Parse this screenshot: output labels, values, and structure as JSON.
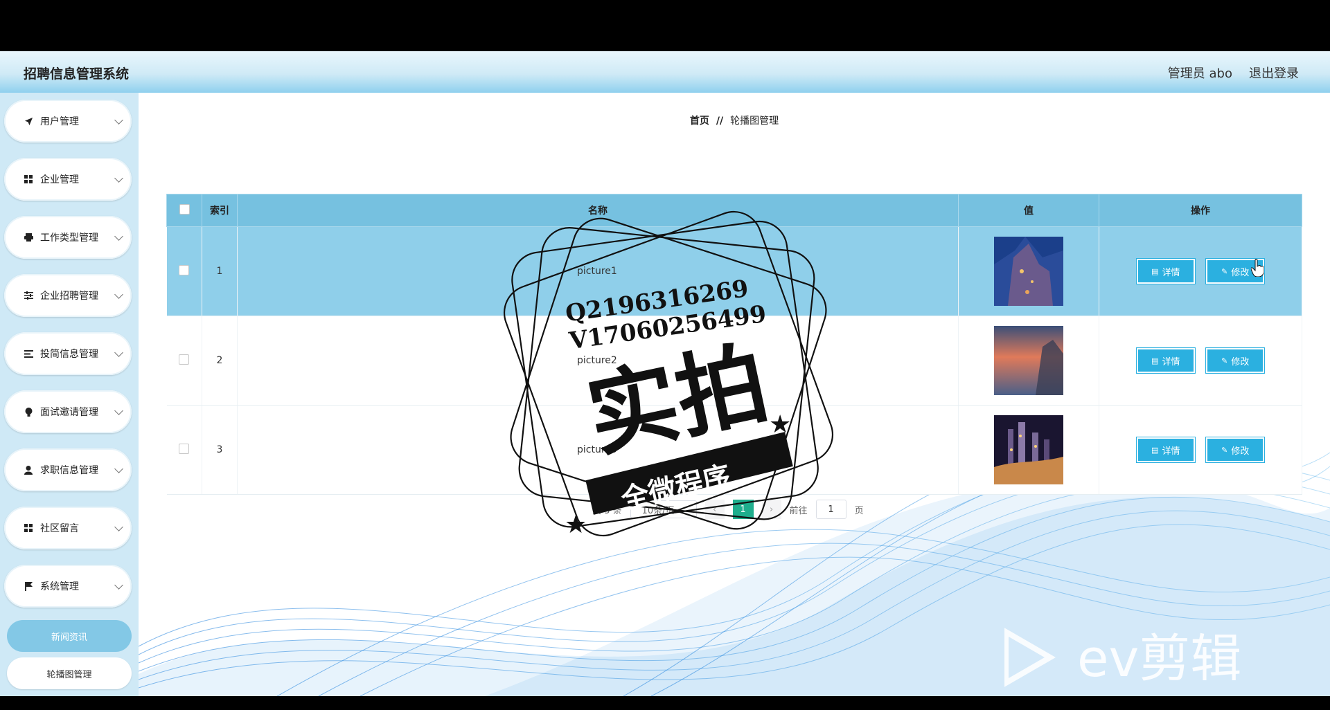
{
  "app": {
    "title": "招聘信息管理系统",
    "user_label": "管理员 abo",
    "logout": "退出登录"
  },
  "sidebar": {
    "items": [
      {
        "label": "用户管理",
        "icon": "paper-plane-icon"
      },
      {
        "label": "企业管理",
        "icon": "grid-icon"
      },
      {
        "label": "工作类型管理",
        "icon": "printer-icon"
      },
      {
        "label": "企业招聘管理",
        "icon": "sliders-icon"
      },
      {
        "label": "投简信息管理",
        "icon": "list-icon"
      },
      {
        "label": "面试邀请管理",
        "icon": "bulb-icon"
      },
      {
        "label": "求职信息管理",
        "icon": "user-icon"
      },
      {
        "label": "社区留言",
        "icon": "grid-icon"
      },
      {
        "label": "系统管理",
        "icon": "flag-icon"
      }
    ],
    "sub_items": [
      {
        "label": "新闻资讯",
        "active": true
      },
      {
        "label": "轮播图管理",
        "active": false
      }
    ]
  },
  "breadcrumb": {
    "home": "首页",
    "sep": "//",
    "current": "轮播图管理"
  },
  "table": {
    "headers": {
      "index": "索引",
      "name": "名称",
      "value": "值",
      "actions": "操作"
    },
    "rows": [
      {
        "index": "1",
        "name": "picture1"
      },
      {
        "index": "2",
        "name": "picture2"
      },
      {
        "index": "3",
        "name": "picture3"
      }
    ],
    "detail_label": "详情",
    "edit_label": "修改"
  },
  "pagination": {
    "total": "共 3 条",
    "page_size": "10条/页",
    "current_page": "1",
    "goto_prefix": "前往",
    "goto_value": "1",
    "goto_suffix": "页"
  },
  "watermark": {
    "qq": "Q2196316269",
    "vx": "V17060256499",
    "main": "实拍",
    "banner": "全微程序",
    "ev": "ev剪辑"
  },
  "colors": {
    "header_accent": "#8fd0ee",
    "sidebar_bg": "#cfe9f6",
    "table_header": "#76c1e0",
    "row_highlight": "#8fcfea",
    "button": "#2bb0e0",
    "pager_active": "#1fae8d"
  }
}
